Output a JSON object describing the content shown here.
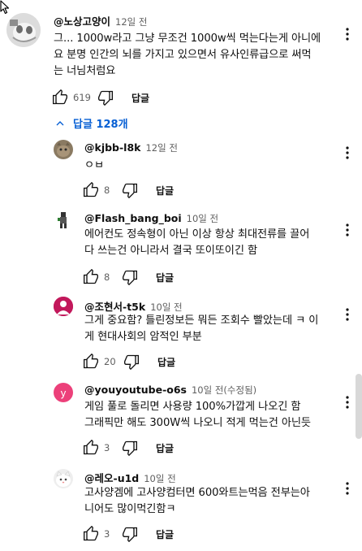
{
  "top_comment": {
    "author": "@노상고양이",
    "time": "12일 전",
    "text": "그...  1000w라고 그냥 무조건 1000w씩 먹는다는게 아니에\n요 분명 인간의 뇌를 가지고 있으면서 유사인류급으로 써먹\n는 너님처럼요",
    "likes": "619",
    "reply_label": "답글"
  },
  "replies_toggle": {
    "label": "답글 128개"
  },
  "replies": [
    {
      "author": "@kjbb-l8k",
      "time": "12일 전",
      "text": "ㅇㅂ",
      "likes": "8",
      "reply_label": "답글",
      "avatar_letter": "",
      "avatar_color": "#8a7a62"
    },
    {
      "author": "@Flash_bang_boi",
      "time": "10일 전",
      "text": "에어컨도 정속형이 아닌 이상 항상 최대전류를 끌어\n다 쓰는건 아니라서 결국 또이또이긴 함",
      "likes": "8",
      "reply_label": "답글",
      "avatar_letter": "",
      "avatar_color": "#ffffff"
    },
    {
      "author": "@조현서-t5k",
      "time": "10일 전",
      "text": "그게 중요함? 틀린정보든 뭐든 조회수 빨았는데 ㅋ 이\n게 현대사회의 암적인 부분",
      "likes": "20",
      "reply_label": "답글",
      "avatar_letter": "",
      "avatar_color": "#c2185b"
    },
    {
      "author": "@youyoutube-o6s",
      "time": "10일 전(수정됨)",
      "text": "게임 풀로 돌리면 사용량 100%가깝게 나오긴 함\n그래픽만 해도 300W씩 나오니 적게 먹는건 아닌듯",
      "likes": "3",
      "reply_label": "답글",
      "avatar_letter": "y",
      "avatar_color": "#ec407a"
    },
    {
      "author": "@레오-u1d",
      "time": "10일 전",
      "text": "고사양겜에 고사양컴터면 600와트는먹음 전부는아\n니어도 많이먹긴함ㅋ",
      "likes": "3",
      "reply_label": "답글",
      "avatar_letter": "",
      "avatar_color": "#eeeeee"
    }
  ],
  "icons": {
    "like": "thumb-up-icon",
    "dislike": "thumb-down-icon",
    "more": "more-vert-icon",
    "chevron": "chevron-up-icon",
    "cursor": "mouse-cursor-icon"
  },
  "colors": {
    "link_blue": "#065fd4",
    "secondary_text": "#606060"
  }
}
